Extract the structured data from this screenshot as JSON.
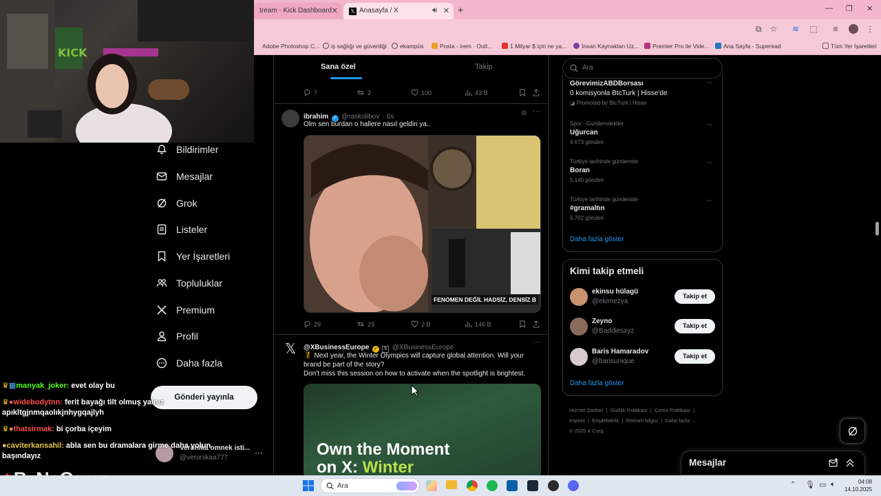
{
  "browser": {
    "tabs": [
      {
        "label": "tream - Kick Dashboard"
      },
      {
        "label": "Anasayfa / X"
      }
    ],
    "bookmarks": [
      {
        "label": "Adobe Photoshop C...",
        "color": "#2e64b5"
      },
      {
        "label": "iş sağlığı ve güvenliği",
        "color": "#444"
      },
      {
        "label": "ekampüs",
        "color": "#444"
      },
      {
        "label": "Posta - irem · Outl...",
        "color": "#e6a02a"
      },
      {
        "label": "1 Milyar $ için ne ya...",
        "color": "#d33"
      },
      {
        "label": "İnsan Kaynakları Uz...",
        "color": "#7b3fa0"
      },
      {
        "label": "Premier Pro ile Vide...",
        "color": "#b7327d"
      },
      {
        "label": "Ana Sayfa - Superead",
        "color": "#1f78c1"
      }
    ],
    "all_bookmarks": "Tüm Yer İşaretleri"
  },
  "chat": [
    {
      "user": "manyak_joker:",
      "msg": "evet olay bu",
      "color": "#53fc18"
    },
    {
      "user": "widebodytnn:",
      "msg": "ferit bayağı tilt olmuş yalnız apıkltgjnmqaolıkjnhygqajlyh",
      "color": "#ff4d4d"
    },
    {
      "user": "thatsirmak:",
      "msg": "bi çorba içeyim",
      "color": "#ff4d4d"
    },
    {
      "user": "caviterkansahil:",
      "msg": "abla sen bu dramalara girme daha yolun başındayız",
      "color": "#e8c24a"
    }
  ],
  "watermark": "ByNoGame",
  "sidebar": {
    "items": [
      {
        "label": "Bildirimler",
        "icon": "bell-icon"
      },
      {
        "label": "Mesajlar",
        "icon": "mail-icon"
      },
      {
        "label": "Grok",
        "icon": "grok-icon"
      },
      {
        "label": "Listeler",
        "icon": "list-icon"
      },
      {
        "label": "Yer İşaretleri",
        "icon": "bookmark-icon"
      },
      {
        "label": "Topluluklar",
        "icon": "communities-icon"
      },
      {
        "label": "Premium",
        "icon": "x-logo-icon"
      },
      {
        "label": "Profil",
        "icon": "profile-icon"
      },
      {
        "label": "Daha fazla",
        "icon": "more-icon"
      }
    ],
    "post_button": "Gönderi yayınla",
    "account": {
      "name": "Veronika omnek isti...",
      "handle": "@veronikaa777"
    }
  },
  "feed": {
    "tabs": [
      "Sana özel",
      "Takip"
    ],
    "prev_actions": {
      "replies": "7",
      "reposts": "2",
      "likes": "100",
      "views": "43 B"
    },
    "post1": {
      "name": "ibrahim",
      "handle": "@raskolibov",
      "time": "· 6s",
      "text": "Olm sen burdan o hallere nasıl geldin ya..",
      "media_caption": "FENOMEN DEĞİL HADSİZ, DENSİZ B",
      "replies": "29",
      "reposts": "29",
      "likes": "2 B",
      "views": "146 B"
    },
    "post2": {
      "name": "@XBusinessEurope",
      "handle": "@XBusinessEurope",
      "text1": "Next year, the Winter Olympics will capture global attention. Will your brand be part of the story?",
      "text2": "Don't miss this session on how to activate when the spotlight is brightest.",
      "media_line1": "Own the Moment",
      "media_line2a": "on X: ",
      "media_line2b": "Winter"
    }
  },
  "right": {
    "search_placeholder": "Ara",
    "trends": [
      {
        "context": "",
        "title": "GörevimizABDBorsası",
        "meta": "0 komisyonla BtcTurk | Hisse'de",
        "promo": "Promoted by BtcTurk | Hisse"
      },
      {
        "context": "Spor · Gündemdekiler",
        "title": "Uğurcan",
        "meta": "4.673 gönderi"
      },
      {
        "context": "Türkiye tarihinde gündemde",
        "title": "Boran",
        "meta": "5.140 gönderi"
      },
      {
        "context": "Türkiye tarihinde gündemde",
        "title": "#gramaltın",
        "meta": "6.702 gönderi"
      }
    ],
    "show_more": "Daha fazla göster",
    "who_to_follow_title": "Kimi takip etmeli",
    "follow": [
      {
        "name": "ekinsu hülagü",
        "handle": "@ekimezya",
        "button": "Takip et"
      },
      {
        "name": "Zeyno",
        "handle": "@Baddlesxyz",
        "button": "Takip et"
      },
      {
        "name": "Baris Hamaradov",
        "handle": "@barisunique",
        "button": "Takip et"
      }
    ],
    "footer": [
      "Hizmet Şartları",
      "Gizlilik Politikası",
      "Çerez Politikası",
      "Imprint",
      "Erişilebilirlik",
      "Reklam bilgisi",
      "Daha fazla ...",
      "© 2025 X Corp."
    ],
    "messages_title": "Mesajlar"
  },
  "taskbar": {
    "search": "Ara",
    "time": "04:08",
    "date": "14.10.2025"
  }
}
